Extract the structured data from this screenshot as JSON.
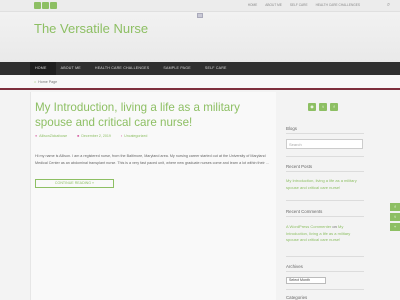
{
  "topbar": {
    "social": [
      "rss-icon",
      "twitter-icon",
      "facebook-icon"
    ],
    "links": [
      "HOME",
      "ABOUT ME",
      "SELF CARE",
      "HEALTH CARE CHALLENGES"
    ],
    "search_icon": "search-icon"
  },
  "site": {
    "title": "The Versatile Nurse"
  },
  "nav": {
    "items": [
      "HOME",
      "ABOUT ME",
      "HEALTH CARE CHALLENGES",
      "SAMPLE PAGE",
      "SELF CARE"
    ]
  },
  "breadcrumb": {
    "label": "Home Page"
  },
  "post": {
    "title": "My Introduction, living a life as a military spouse and critical care nurse!",
    "author": "AllisonZickafoose",
    "date": "December 2, 2019",
    "category": "Uncategorized",
    "excerpt": "Hi my name is Allison. I am a registered nurse, from the Baltimore, Maryland area. My nursing career started out at the University of Maryland Medical Center as an abdominal transplant nurse. This is a very fast paced unit, where new graduate nurses come and learn a lot within their …",
    "read_more": "CONTINUE READING »"
  },
  "sidebar": {
    "blogs_title": "Blogs",
    "search_placeholder": "Search",
    "recent_posts_title": "Recent Posts",
    "recent_posts": [
      "My Introduction, living a life as a military spouse and critical care nurse!"
    ],
    "recent_comments_title": "Recent Comments",
    "comment_author": "A WordPress Commenter",
    "comment_on": "on",
    "comment_post": "My Introduction, living a life as a military spouse and critical care nurse!",
    "archives_title": "Archives",
    "archives_select": "Select Month",
    "categories_title": "Categories"
  },
  "colors": {
    "accent": "#8dbf63",
    "nav_bg": "#2f2f2f",
    "rule": "#7d2e3c"
  }
}
